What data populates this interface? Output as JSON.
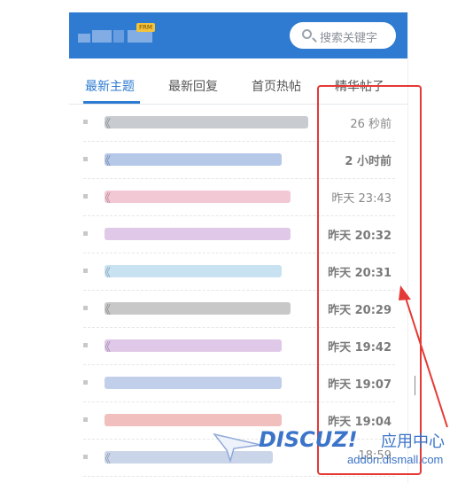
{
  "header": {
    "badge": "FRM",
    "search_placeholder": "搜索关键字",
    "bg_color": "#2f7bd1"
  },
  "tabs": [
    {
      "label": "最新主题",
      "active": true
    },
    {
      "label": "最新回复",
      "active": false
    },
    {
      "label": "首页热帖",
      "active": false
    },
    {
      "label": "精华帖子",
      "active": false
    }
  ],
  "rows": [
    {
      "prefix": "《",
      "time": "26 秒前",
      "bold": false,
      "color": "#9aa0a8"
    },
    {
      "prefix": "《",
      "time": "2 小时前",
      "bold": true,
      "color": "#7a9bd6"
    },
    {
      "prefix": "《",
      "time": "昨天 23:43",
      "bold": false,
      "color": "#e89ab0"
    },
    {
      "prefix": "",
      "time": "昨天 20:32",
      "bold": true,
      "color": "#c79ad6"
    },
    {
      "prefix": "《",
      "time": "昨天 20:31",
      "bold": true,
      "color": "#9ccbe8"
    },
    {
      "prefix": "《",
      "time": "昨天 20:29",
      "bold": true,
      "color": "#9a9a9a"
    },
    {
      "prefix": "《",
      "time": "昨天 19:42",
      "bold": true,
      "color": "#c79ad6"
    },
    {
      "prefix": "",
      "time": "昨天 19:07",
      "bold": true,
      "color": "#8fa8d8"
    },
    {
      "prefix": "",
      "time": "昨天 19:04",
      "bold": true,
      "color": "#e88a8a"
    },
    {
      "prefix": "《",
      "time": "18:59",
      "bold": false,
      "color": "#9fb3d8"
    }
  ],
  "watermark": {
    "brand": "DISCUZ!",
    "label": "应用中心",
    "url": "addon.dismall.com"
  },
  "annotation_color": "#e53935"
}
